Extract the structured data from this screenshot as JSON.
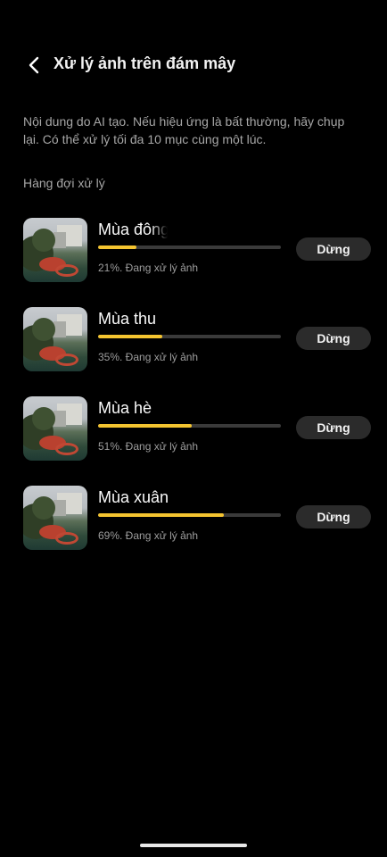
{
  "header": {
    "title": "Xử lý ảnh trên đám mây"
  },
  "description": "Nội dung do AI tạo. Nếu hiệu ứng là bất thường, hãy chụp lại. Có thể xử lý tối đa 10 mục cùng một lúc.",
  "section_title": "Hàng đợi xử lý",
  "queue": [
    {
      "name": "Mùa đông",
      "progress": 21,
      "status": "21%. Đang xử lý ảnh",
      "button": "Dừng"
    },
    {
      "name": "Mùa thu",
      "progress": 35,
      "status": "35%. Đang xử lý ảnh",
      "button": "Dừng"
    },
    {
      "name": "Mùa hè",
      "progress": 51,
      "status": "51%. Đang xử lý ảnh",
      "button": "Dừng"
    },
    {
      "name": "Mùa xuân",
      "progress": 69,
      "status": "69%. Đang xử lý ảnh",
      "button": "Dừng"
    }
  ],
  "colors": {
    "accent": "#f4c430",
    "background": "#000000",
    "button_bg": "#2b2b2b"
  }
}
